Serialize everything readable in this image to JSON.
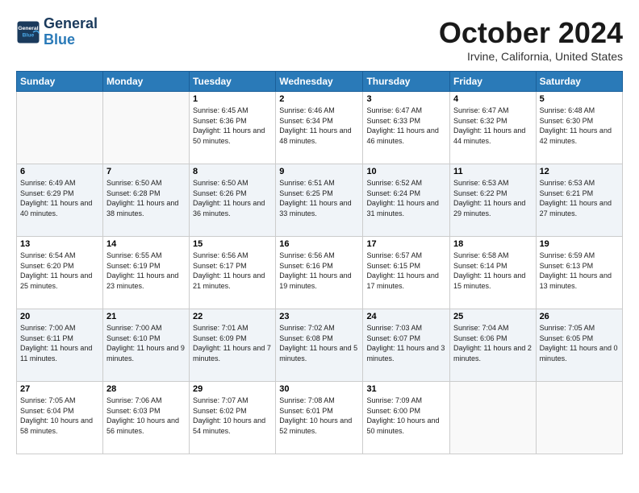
{
  "header": {
    "logo_line1": "General",
    "logo_line2": "Blue",
    "month": "October 2024",
    "location": "Irvine, California, United States"
  },
  "days_of_week": [
    "Sunday",
    "Monday",
    "Tuesday",
    "Wednesday",
    "Thursday",
    "Friday",
    "Saturday"
  ],
  "weeks": [
    [
      {
        "day": "",
        "info": ""
      },
      {
        "day": "",
        "info": ""
      },
      {
        "day": "1",
        "info": "Sunrise: 6:45 AM\nSunset: 6:36 PM\nDaylight: 11 hours and 50 minutes."
      },
      {
        "day": "2",
        "info": "Sunrise: 6:46 AM\nSunset: 6:34 PM\nDaylight: 11 hours and 48 minutes."
      },
      {
        "day": "3",
        "info": "Sunrise: 6:47 AM\nSunset: 6:33 PM\nDaylight: 11 hours and 46 minutes."
      },
      {
        "day": "4",
        "info": "Sunrise: 6:47 AM\nSunset: 6:32 PM\nDaylight: 11 hours and 44 minutes."
      },
      {
        "day": "5",
        "info": "Sunrise: 6:48 AM\nSunset: 6:30 PM\nDaylight: 11 hours and 42 minutes."
      }
    ],
    [
      {
        "day": "6",
        "info": "Sunrise: 6:49 AM\nSunset: 6:29 PM\nDaylight: 11 hours and 40 minutes."
      },
      {
        "day": "7",
        "info": "Sunrise: 6:50 AM\nSunset: 6:28 PM\nDaylight: 11 hours and 38 minutes."
      },
      {
        "day": "8",
        "info": "Sunrise: 6:50 AM\nSunset: 6:26 PM\nDaylight: 11 hours and 36 minutes."
      },
      {
        "day": "9",
        "info": "Sunrise: 6:51 AM\nSunset: 6:25 PM\nDaylight: 11 hours and 33 minutes."
      },
      {
        "day": "10",
        "info": "Sunrise: 6:52 AM\nSunset: 6:24 PM\nDaylight: 11 hours and 31 minutes."
      },
      {
        "day": "11",
        "info": "Sunrise: 6:53 AM\nSunset: 6:22 PM\nDaylight: 11 hours and 29 minutes."
      },
      {
        "day": "12",
        "info": "Sunrise: 6:53 AM\nSunset: 6:21 PM\nDaylight: 11 hours and 27 minutes."
      }
    ],
    [
      {
        "day": "13",
        "info": "Sunrise: 6:54 AM\nSunset: 6:20 PM\nDaylight: 11 hours and 25 minutes."
      },
      {
        "day": "14",
        "info": "Sunrise: 6:55 AM\nSunset: 6:19 PM\nDaylight: 11 hours and 23 minutes."
      },
      {
        "day": "15",
        "info": "Sunrise: 6:56 AM\nSunset: 6:17 PM\nDaylight: 11 hours and 21 minutes."
      },
      {
        "day": "16",
        "info": "Sunrise: 6:56 AM\nSunset: 6:16 PM\nDaylight: 11 hours and 19 minutes."
      },
      {
        "day": "17",
        "info": "Sunrise: 6:57 AM\nSunset: 6:15 PM\nDaylight: 11 hours and 17 minutes."
      },
      {
        "day": "18",
        "info": "Sunrise: 6:58 AM\nSunset: 6:14 PM\nDaylight: 11 hours and 15 minutes."
      },
      {
        "day": "19",
        "info": "Sunrise: 6:59 AM\nSunset: 6:13 PM\nDaylight: 11 hours and 13 minutes."
      }
    ],
    [
      {
        "day": "20",
        "info": "Sunrise: 7:00 AM\nSunset: 6:11 PM\nDaylight: 11 hours and 11 minutes."
      },
      {
        "day": "21",
        "info": "Sunrise: 7:00 AM\nSunset: 6:10 PM\nDaylight: 11 hours and 9 minutes."
      },
      {
        "day": "22",
        "info": "Sunrise: 7:01 AM\nSunset: 6:09 PM\nDaylight: 11 hours and 7 minutes."
      },
      {
        "day": "23",
        "info": "Sunrise: 7:02 AM\nSunset: 6:08 PM\nDaylight: 11 hours and 5 minutes."
      },
      {
        "day": "24",
        "info": "Sunrise: 7:03 AM\nSunset: 6:07 PM\nDaylight: 11 hours and 3 minutes."
      },
      {
        "day": "25",
        "info": "Sunrise: 7:04 AM\nSunset: 6:06 PM\nDaylight: 11 hours and 2 minutes."
      },
      {
        "day": "26",
        "info": "Sunrise: 7:05 AM\nSunset: 6:05 PM\nDaylight: 11 hours and 0 minutes."
      }
    ],
    [
      {
        "day": "27",
        "info": "Sunrise: 7:05 AM\nSunset: 6:04 PM\nDaylight: 10 hours and 58 minutes."
      },
      {
        "day": "28",
        "info": "Sunrise: 7:06 AM\nSunset: 6:03 PM\nDaylight: 10 hours and 56 minutes."
      },
      {
        "day": "29",
        "info": "Sunrise: 7:07 AM\nSunset: 6:02 PM\nDaylight: 10 hours and 54 minutes."
      },
      {
        "day": "30",
        "info": "Sunrise: 7:08 AM\nSunset: 6:01 PM\nDaylight: 10 hours and 52 minutes."
      },
      {
        "day": "31",
        "info": "Sunrise: 7:09 AM\nSunset: 6:00 PM\nDaylight: 10 hours and 50 minutes."
      },
      {
        "day": "",
        "info": ""
      },
      {
        "day": "",
        "info": ""
      }
    ]
  ]
}
